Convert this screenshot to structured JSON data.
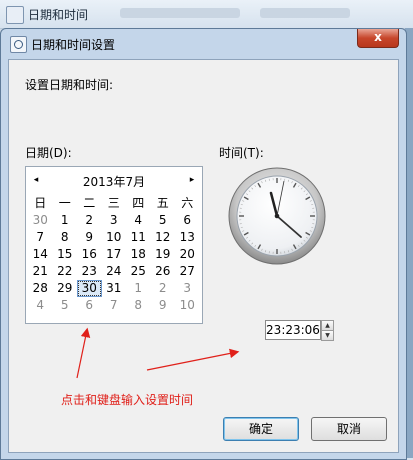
{
  "background_window": {
    "title": "日期和时间"
  },
  "dialog": {
    "title": "日期和时间设置",
    "close_glyph": "x",
    "instruction": "设置日期和时间:",
    "date_label": "日期(D):",
    "time_label": "时间(T):",
    "calendar": {
      "month_title": "2013年7月",
      "prev_glyph": "◂",
      "next_glyph": "▸",
      "weekdays": [
        "日",
        "一",
        "二",
        "三",
        "四",
        "五",
        "六"
      ],
      "days": [
        [
          "30",
          "1",
          "2",
          "3",
          "4",
          "5",
          "6"
        ],
        [
          "7",
          "8",
          "9",
          "10",
          "11",
          "12",
          "13"
        ],
        [
          "14",
          "15",
          "16",
          "17",
          "18",
          "19",
          "20"
        ],
        [
          "21",
          "22",
          "23",
          "24",
          "25",
          "26",
          "27"
        ],
        [
          "28",
          "29",
          "30",
          "31",
          "1",
          "2",
          "3"
        ],
        [
          "4",
          "5",
          "6",
          "7",
          "8",
          "9",
          "10"
        ]
      ],
      "selected_day": "30"
    },
    "time_value": "23:23:06",
    "spin_up_glyph": "▲",
    "spin_down_glyph": "▼",
    "annotation": "点击和键盘输入设置时间",
    "ok_label": "确定",
    "cancel_label": "取消"
  },
  "colors": {
    "annotation": "#e0201a",
    "arrow": "#e0201a"
  },
  "icons": [
    "clock-face-icon",
    "window-icon",
    "close-icon",
    "prev-month-icon",
    "next-month-icon",
    "spin-up-icon",
    "spin-down-icon"
  ]
}
